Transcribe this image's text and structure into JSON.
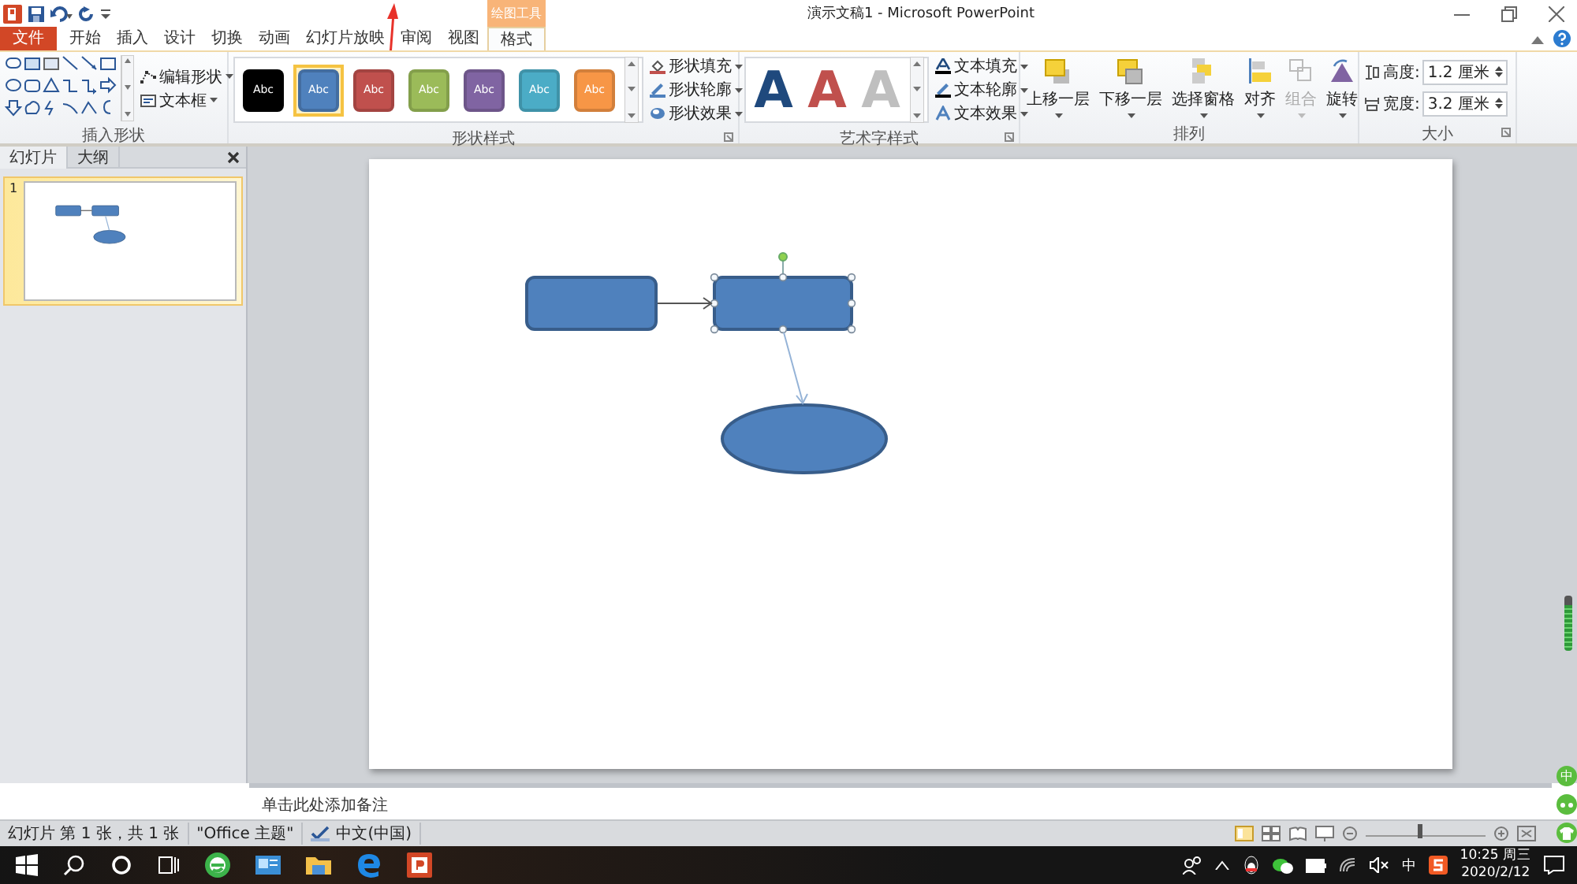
{
  "window": {
    "title": "演示文稿1 - Microsoft PowerPoint"
  },
  "contextual_group": "绘图工具",
  "tabs": [
    {
      "label": "文件",
      "kind": "file",
      "selected": false
    },
    {
      "label": "开始",
      "kind": "normal",
      "selected": false
    },
    {
      "label": "插入",
      "kind": "normal",
      "selected": false
    },
    {
      "label": "设计",
      "kind": "normal",
      "selected": false
    },
    {
      "label": "切换",
      "kind": "normal",
      "selected": false
    },
    {
      "label": "动画",
      "kind": "normal",
      "selected": false
    },
    {
      "label": "幻灯片放映",
      "kind": "normal",
      "selected": false
    },
    {
      "label": "审阅",
      "kind": "normal",
      "selected": false
    },
    {
      "label": "视图",
      "kind": "normal",
      "selected": false
    },
    {
      "label": "格式",
      "kind": "contextual",
      "selected": true
    }
  ],
  "ribbon": {
    "insert_shapes": {
      "title": "插入形状",
      "commands": [
        "编辑形状",
        "文本框"
      ]
    },
    "shape_styles": {
      "title": "形状样式",
      "swatches": [
        {
          "label": "Abc",
          "color": "#000000",
          "selected": false
        },
        {
          "label": "Abc",
          "color": "#4f81bd",
          "selected": true
        },
        {
          "label": "Abc",
          "color": "#c0504d",
          "selected": false
        },
        {
          "label": "Abc",
          "color": "#9bbb59",
          "selected": false
        },
        {
          "label": "Abc",
          "color": "#8064a2",
          "selected": false
        },
        {
          "label": "Abc",
          "color": "#4bacc6",
          "selected": false
        },
        {
          "label": "Abc",
          "color": "#f79646",
          "selected": false
        }
      ],
      "commands": [
        "形状填充",
        "形状轮廓",
        "形状效果"
      ]
    },
    "wordart": {
      "title": "艺术字样式",
      "letters": [
        {
          "label": "A",
          "color": "#1f497d"
        },
        {
          "label": "A",
          "color": "#c0504d"
        },
        {
          "label": "A",
          "color": "#bfbfbf"
        }
      ],
      "commands": [
        "文本填充",
        "文本轮廓",
        "文本效果"
      ]
    },
    "arrange": {
      "title": "排列",
      "buttons": [
        {
          "label": "上移一层",
          "disabled": false
        },
        {
          "label": "下移一层",
          "disabled": false
        },
        {
          "label": "选择窗格",
          "disabled": false
        },
        {
          "label": "对齐",
          "disabled": false
        },
        {
          "label": "组合",
          "disabled": true
        },
        {
          "label": "旋转",
          "disabled": false
        }
      ]
    },
    "size": {
      "title": "大小",
      "fields": [
        {
          "label": "高度:",
          "value": "1.2 厘米"
        },
        {
          "label": "宽度:",
          "value": "3.2 厘米"
        }
      ]
    }
  },
  "pane": {
    "tabs": [
      {
        "label": "幻灯片",
        "selected": true
      },
      {
        "label": "大纲",
        "selected": false
      }
    ],
    "thumbnails": [
      {
        "number": "1",
        "selected": true
      }
    ]
  },
  "slide": {
    "shapes": [
      {
        "kind": "rect",
        "selected": false
      },
      {
        "kind": "rect",
        "selected": true
      },
      {
        "kind": "ellipse",
        "selected": false
      }
    ]
  },
  "notes": {
    "placeholder": "单击此处添加备注"
  },
  "status_bar": {
    "items": [
      "幻灯片 第 1 张，共 1 张",
      "\"Office 主题\"",
      "中文(中国)"
    ],
    "zoom": {
      "level": 0.45
    }
  },
  "side_toolbar": {
    "label": "中"
  },
  "taskbar": {
    "ime": "中",
    "time": "10:25 周三",
    "date": "2020/2/12"
  }
}
